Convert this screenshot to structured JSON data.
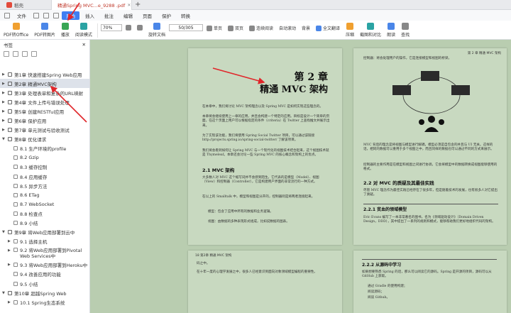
{
  "tabs": [
    {
      "label": "稻壳",
      "active": false
    },
    {
      "label": "精通Spring MVC...e_9288 .pdf",
      "active": true
    }
  ],
  "menu": {
    "items": [
      "文件",
      "开始",
      "插入",
      "批注",
      "编辑",
      "页面",
      "保护",
      "转换"
    ],
    "active": "开始"
  },
  "ribbon": {
    "buttons": [
      "PDF转Office",
      "PDF转图片",
      "播放",
      "阅读模式",
      "旋转文档",
      "单页",
      "双页",
      "连续阅读",
      "自动滚动",
      "背景",
      "全文翻译",
      "压缩",
      "截图和对比",
      "朗读",
      "查找"
    ],
    "zoom": "70%",
    "page_indicator": "50/305"
  },
  "sidebar": {
    "title": "书签",
    "toc": [
      {
        "label": "第1章 快速搭建Spring Web应用",
        "level": 1,
        "expanded": false
      },
      {
        "label": "第2章 精通MVC架构",
        "level": 1,
        "expanded": false,
        "selected": true
      },
      {
        "label": "第3章 处理表单和复杂的URL映射",
        "level": 1,
        "expanded": false
      },
      {
        "label": "第4章 文件上传与错误处理",
        "level": 1,
        "expanded": false
      },
      {
        "label": "第5章 创建RESTful应用",
        "level": 1,
        "expanded": false
      },
      {
        "label": "第6章 保护应用",
        "level": 1,
        "expanded": false
      },
      {
        "label": "第7章 单元测试与验收测试",
        "level": 1,
        "expanded": false
      },
      {
        "label": "第8章 优化请求",
        "level": 1,
        "expanded": true
      },
      {
        "label": "8.1 生产环境的profile",
        "level": 2
      },
      {
        "label": "8.2 Gzip",
        "level": 2
      },
      {
        "label": "8.3 缓存控制",
        "level": 2
      },
      {
        "label": "8.4 应用缓存",
        "level": 2
      },
      {
        "label": "8.5 异步方法",
        "level": 2
      },
      {
        "label": "8.6 ETag",
        "level": 2
      },
      {
        "label": "8.7 WebSocket",
        "level": 2
      },
      {
        "label": "8.8 检查点",
        "level": 2
      },
      {
        "label": "8.9 小结",
        "level": 2
      },
      {
        "label": "第9章 将Web应用部署到云中",
        "level": 1,
        "expanded": true
      },
      {
        "label": "9.1 选择主机",
        "level": 2,
        "expanded": false
      },
      {
        "label": "9.2 将Web应用部署到Pivotal Web Services中",
        "level": 2,
        "expanded": false,
        "multiline": true
      },
      {
        "label": "9.3 将Web应用部署到Heroku中",
        "level": 2,
        "expanded": false
      },
      {
        "label": "9.4 改善应用的功能",
        "level": 2
      },
      {
        "label": "9.5 小结",
        "level": 2
      },
      {
        "label": "第10章 超越Spring Web",
        "level": 1,
        "expanded": true
      },
      {
        "label": "10.1 Spring生态系统",
        "level": 2,
        "expanded": false
      }
    ]
  },
  "document": {
    "page1": {
      "chapter_number": "第 2 章",
      "chapter_title": "精通 MVC 架构",
      "intro1": "在本章中，我们将讨论 MVC 架构理念以及 Spring MVC 是如何实现这些理念的。",
      "intro2": "本章将会继续使用上一章的应用，并且会构建一个特定的应用。目标是设计一个简单的页面，在这个页面上用户可以根据指定的条件（criteria）在 Twitter 上查找推文并展示出来。",
      "intro3": "为了实现该功能，我们将使用 Spring Social Twitter 项目，可以通过该链接 http://projects.spring.io/spring-social-twitter/ 了解该项目。",
      "intro4": "我们将会看到如何让 Spring MVC 与一个现代化的视图技术结合起来，这个视图技术就是 Thymeleaf。本章还会讨论一些 Spring MVC 的核心概念和架构上的优点。",
      "h_mvc": "2.1 MVC 架构",
      "mvc_text": "大多数人对 MVC 这个缩写词并不会感到陌生。它代表的是模型（Model）、视图（View）和控制器（Controller），它是构建用户界面的非常流行的一种方式。",
      "mvc_text2": "在以上的 Smalltalk 中，模型和视图是分开的，控制器则是将两者连接起来。",
      "bullets": [
        "模型：包含了应用中所有的数据和业务逻辑。",
        "视图：由数据的多种表现形式组成，比如说数据的图表。"
      ]
    },
    "page2": {
      "running_head": "第 2 章 精通 MVC 架构",
      "top_bullet": "控制器：将会处理用户的操作，它是连接模型和视图的桥梁。",
      "text1": "MVC 背后的理念是将视图与模型进行解耦，模型必须是自包含的并且与 UI 无关。这样的话，相同的数据可以重用于多个视图之中，而且同样的数据也可以通过不同的方式来展示。",
      "text2": "控制器的主要作用是在模型和视图之间进行协调，它会将模型中的数据转换成视图能够使用的格式。",
      "h_practice": "2.2 对 MVC 的质疑及其最佳实践",
      "text3": "尽管 MVC 理念作为最佳实践已经存在了很多年，但是随着技术的发展，也有很多人对它提出了质疑。",
      "h_anemic": "2.2.1 贫血的领域模型",
      "text4": "Eric Evans 编写了一本非常著名的图书，名为《领域驱动设计》（Domain Driven Design，DDD），其中提出了一系列的规则和模式，能够帮助我们更好地组织代码的架构。"
    },
    "page3": {
      "running_head": "18 第2章 精通 MVC 架构",
      "text1": "码之中。",
      "text2": "在十年一度的心理学发展之中，很多人已经意识到面向对象领域模型编程的重要性。"
    },
    "page4": {
      "h_learn": "2.2.2 从源码中学习",
      "text1": "如果想要熟悉 Spring 的话，那么可以阅读它的源码。Spring 是开源的项目，源码可以从 GitHub 上获取。",
      "bullets": [
        "通过 Gradle 的使用构建；",
        "阅读源码；",
        "阅读 Github。"
      ]
    }
  },
  "colors": {
    "accent": "#3f7ef2",
    "tab_active_text": "#c0392b",
    "annotation": "#e0262a",
    "doc_background": "#b9cdb0"
  }
}
